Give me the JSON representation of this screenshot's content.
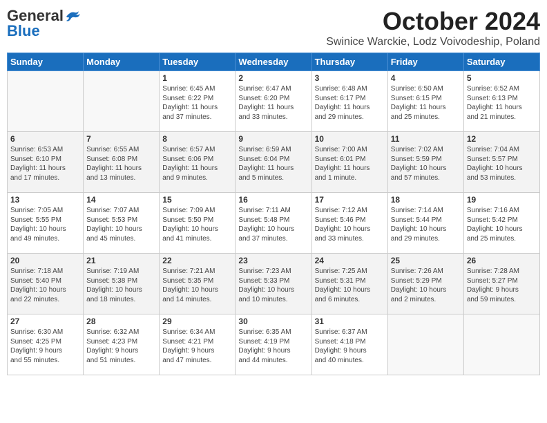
{
  "header": {
    "logo_general": "General",
    "logo_blue": "Blue",
    "month": "October 2024",
    "location": "Swinice Warckie, Lodz Voivodeship, Poland"
  },
  "weekdays": [
    "Sunday",
    "Monday",
    "Tuesday",
    "Wednesday",
    "Thursday",
    "Friday",
    "Saturday"
  ],
  "weeks": [
    [
      {
        "day": "",
        "content": ""
      },
      {
        "day": "",
        "content": ""
      },
      {
        "day": "1",
        "content": "Sunrise: 6:45 AM\nSunset: 6:22 PM\nDaylight: 11 hours\nand 37 minutes."
      },
      {
        "day": "2",
        "content": "Sunrise: 6:47 AM\nSunset: 6:20 PM\nDaylight: 11 hours\nand 33 minutes."
      },
      {
        "day": "3",
        "content": "Sunrise: 6:48 AM\nSunset: 6:17 PM\nDaylight: 11 hours\nand 29 minutes."
      },
      {
        "day": "4",
        "content": "Sunrise: 6:50 AM\nSunset: 6:15 PM\nDaylight: 11 hours\nand 25 minutes."
      },
      {
        "day": "5",
        "content": "Sunrise: 6:52 AM\nSunset: 6:13 PM\nDaylight: 11 hours\nand 21 minutes."
      }
    ],
    [
      {
        "day": "6",
        "content": "Sunrise: 6:53 AM\nSunset: 6:10 PM\nDaylight: 11 hours\nand 17 minutes."
      },
      {
        "day": "7",
        "content": "Sunrise: 6:55 AM\nSunset: 6:08 PM\nDaylight: 11 hours\nand 13 minutes."
      },
      {
        "day": "8",
        "content": "Sunrise: 6:57 AM\nSunset: 6:06 PM\nDaylight: 11 hours\nand 9 minutes."
      },
      {
        "day": "9",
        "content": "Sunrise: 6:59 AM\nSunset: 6:04 PM\nDaylight: 11 hours\nand 5 minutes."
      },
      {
        "day": "10",
        "content": "Sunrise: 7:00 AM\nSunset: 6:01 PM\nDaylight: 11 hours\nand 1 minute."
      },
      {
        "day": "11",
        "content": "Sunrise: 7:02 AM\nSunset: 5:59 PM\nDaylight: 10 hours\nand 57 minutes."
      },
      {
        "day": "12",
        "content": "Sunrise: 7:04 AM\nSunset: 5:57 PM\nDaylight: 10 hours\nand 53 minutes."
      }
    ],
    [
      {
        "day": "13",
        "content": "Sunrise: 7:05 AM\nSunset: 5:55 PM\nDaylight: 10 hours\nand 49 minutes."
      },
      {
        "day": "14",
        "content": "Sunrise: 7:07 AM\nSunset: 5:53 PM\nDaylight: 10 hours\nand 45 minutes."
      },
      {
        "day": "15",
        "content": "Sunrise: 7:09 AM\nSunset: 5:50 PM\nDaylight: 10 hours\nand 41 minutes."
      },
      {
        "day": "16",
        "content": "Sunrise: 7:11 AM\nSunset: 5:48 PM\nDaylight: 10 hours\nand 37 minutes."
      },
      {
        "day": "17",
        "content": "Sunrise: 7:12 AM\nSunset: 5:46 PM\nDaylight: 10 hours\nand 33 minutes."
      },
      {
        "day": "18",
        "content": "Sunrise: 7:14 AM\nSunset: 5:44 PM\nDaylight: 10 hours\nand 29 minutes."
      },
      {
        "day": "19",
        "content": "Sunrise: 7:16 AM\nSunset: 5:42 PM\nDaylight: 10 hours\nand 25 minutes."
      }
    ],
    [
      {
        "day": "20",
        "content": "Sunrise: 7:18 AM\nSunset: 5:40 PM\nDaylight: 10 hours\nand 22 minutes."
      },
      {
        "day": "21",
        "content": "Sunrise: 7:19 AM\nSunset: 5:38 PM\nDaylight: 10 hours\nand 18 minutes."
      },
      {
        "day": "22",
        "content": "Sunrise: 7:21 AM\nSunset: 5:35 PM\nDaylight: 10 hours\nand 14 minutes."
      },
      {
        "day": "23",
        "content": "Sunrise: 7:23 AM\nSunset: 5:33 PM\nDaylight: 10 hours\nand 10 minutes."
      },
      {
        "day": "24",
        "content": "Sunrise: 7:25 AM\nSunset: 5:31 PM\nDaylight: 10 hours\nand 6 minutes."
      },
      {
        "day": "25",
        "content": "Sunrise: 7:26 AM\nSunset: 5:29 PM\nDaylight: 10 hours\nand 2 minutes."
      },
      {
        "day": "26",
        "content": "Sunrise: 7:28 AM\nSunset: 5:27 PM\nDaylight: 9 hours\nand 59 minutes."
      }
    ],
    [
      {
        "day": "27",
        "content": "Sunrise: 6:30 AM\nSunset: 4:25 PM\nDaylight: 9 hours\nand 55 minutes."
      },
      {
        "day": "28",
        "content": "Sunrise: 6:32 AM\nSunset: 4:23 PM\nDaylight: 9 hours\nand 51 minutes."
      },
      {
        "day": "29",
        "content": "Sunrise: 6:34 AM\nSunset: 4:21 PM\nDaylight: 9 hours\nand 47 minutes."
      },
      {
        "day": "30",
        "content": "Sunrise: 6:35 AM\nSunset: 4:19 PM\nDaylight: 9 hours\nand 44 minutes."
      },
      {
        "day": "31",
        "content": "Sunrise: 6:37 AM\nSunset: 4:18 PM\nDaylight: 9 hours\nand 40 minutes."
      },
      {
        "day": "",
        "content": ""
      },
      {
        "day": "",
        "content": ""
      }
    ]
  ]
}
